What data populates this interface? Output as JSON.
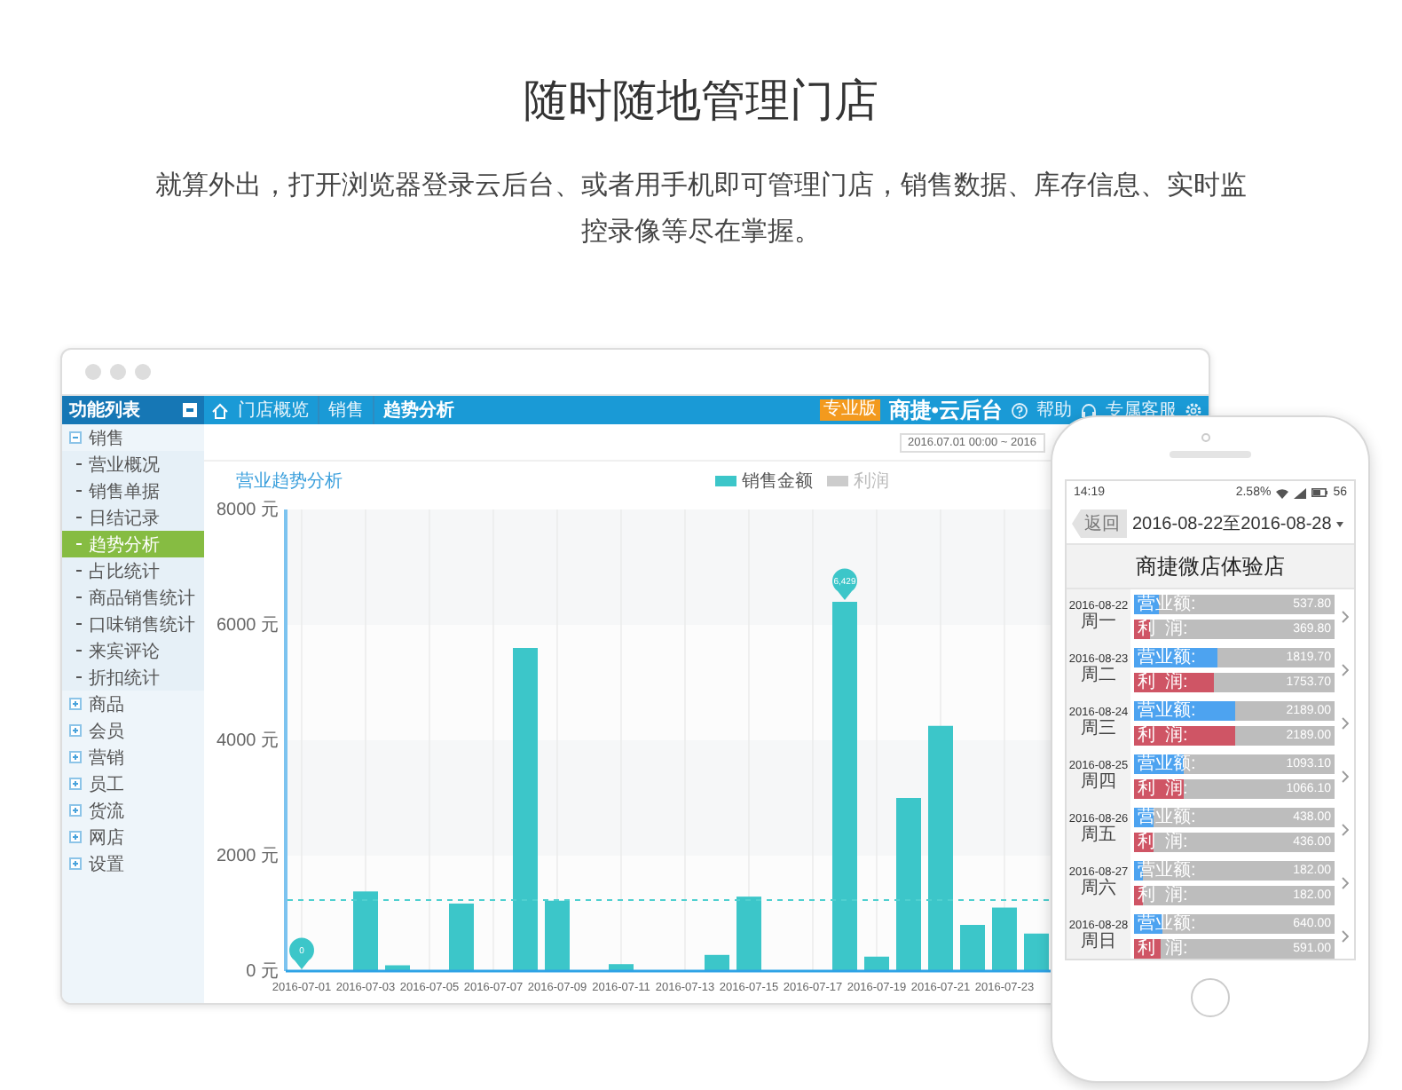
{
  "page": {
    "title": "随时随地管理门店",
    "description": "就算外出，打开浏览器登录云后台、或者用手机即可管理门店，销售数据、库存信息、实时监控录像等尽在掌握。"
  },
  "desktop": {
    "sidebar": {
      "title": "功能列表",
      "items": [
        {
          "label": "销售",
          "expanded": true,
          "children": [
            {
              "label": "营业概况",
              "selected": false
            },
            {
              "label": "销售单据",
              "selected": false
            },
            {
              "label": "日结记录",
              "selected": false
            },
            {
              "label": "趋势分析",
              "selected": true
            },
            {
              "label": "占比统计",
              "selected": false
            },
            {
              "label": "商品销售统计",
              "selected": false
            },
            {
              "label": "口味销售统计",
              "selected": false
            },
            {
              "label": "来宾评论",
              "selected": false
            },
            {
              "label": "折扣统计",
              "selected": false
            }
          ]
        },
        {
          "label": "商品",
          "expanded": false
        },
        {
          "label": "会员",
          "expanded": false
        },
        {
          "label": "营销",
          "expanded": false
        },
        {
          "label": "员工",
          "expanded": false
        },
        {
          "label": "货流",
          "expanded": false
        },
        {
          "label": "网店",
          "expanded": false
        },
        {
          "label": "设置",
          "expanded": false
        }
      ]
    },
    "breadcrumb": [
      "门店概览",
      "销售",
      "趋势分析"
    ],
    "edition_badge": "专业版",
    "brand": "商捷•云后台",
    "help": "帮助",
    "service": "专属客服",
    "date_range": "2016.07.01 00:00 ~ 2016",
    "chart": {
      "title": "营业趋势分析",
      "hidden_series": [
        {
          "label": "利润",
          "color": "#cccccc"
        }
      ],
      "chart_data": {
        "type": "bar",
        "categories": [
          "2016-07-01",
          null,
          "2016-07-03",
          null,
          "2016-07-05",
          null,
          "2016-07-07",
          null,
          "2016-07-09",
          null,
          "2016-07-11",
          null,
          "2016-07-13",
          null,
          "2016-07-15",
          null,
          "2016-07-17",
          null,
          "2016-07-19",
          null,
          "2016-07-21",
          null,
          "2016-07-23",
          null
        ],
        "series": [
          {
            "name": "销售金额",
            "color": "#3cc6c9",
            "values": [
              0,
              0,
              1380,
              100,
              0,
              1170,
              0,
              5600,
              1220,
              0,
              120,
              0,
              null,
              280,
              1290,
              0,
              0,
              6400,
              250,
              3000,
              4250,
              800,
              1100,
              650
            ]
          }
        ],
        "grid": true,
        "ylim": [
          0,
          8000
        ],
        "yticks": [
          {
            "value": 0,
            "label": "0 元"
          },
          {
            "value": 2000,
            "label": "2000 元"
          },
          {
            "value": 4000,
            "label": "4000 元"
          },
          {
            "value": 6000,
            "label": "6000 元"
          },
          {
            "value": 8000,
            "label": "8000 元"
          }
        ],
        "ref_lines": [
          {
            "axis": "y",
            "value": 1230
          }
        ],
        "annotations": [
          {
            "y": 0,
            "text": "0"
          },
          {
            "y": 6400,
            "text": "6,429"
          }
        ]
      }
    }
  },
  "phone": {
    "status": {
      "time": "14:19",
      "network": "2.58%",
      "battery": "56"
    },
    "back": "返回",
    "range": "2016-08-22至2016-08-28",
    "store": "商捷微店体验店",
    "days": [
      {
        "date": "2016-08-22",
        "weekday": "周一",
        "metrics": [
          {
            "kind": "revenue",
            "label": "营业额:",
            "value": "537.80",
            "level": 0.12
          },
          {
            "kind": "profit",
            "label": "利  润:",
            "value": "369.80",
            "level": 0.08
          }
        ]
      },
      {
        "date": "2016-08-23",
        "weekday": "周二",
        "metrics": [
          {
            "kind": "revenue",
            "label": "营业额:",
            "value": "1819.70",
            "level": 0.42
          },
          {
            "kind": "profit",
            "label": "利  润:",
            "value": "1753.70",
            "level": 0.4
          }
        ]
      },
      {
        "date": "2016-08-24",
        "weekday": "周三",
        "metrics": [
          {
            "kind": "revenue",
            "label": "营业额:",
            "value": "2189.00",
            "level": 0.5
          },
          {
            "kind": "profit",
            "label": "利  润:",
            "value": "2189.00",
            "level": 0.5
          }
        ]
      },
      {
        "date": "2016-08-25",
        "weekday": "周四",
        "metrics": [
          {
            "kind": "revenue",
            "label": "营业额:",
            "value": "1093.10",
            "level": 0.25
          },
          {
            "kind": "profit",
            "label": "利  润:",
            "value": "1066.10",
            "level": 0.25
          }
        ]
      },
      {
        "date": "2016-08-26",
        "weekday": "周五",
        "metrics": [
          {
            "kind": "revenue",
            "label": "营业额:",
            "value": "438.00",
            "level": 0.1
          },
          {
            "kind": "profit",
            "label": "利  润:",
            "value": "436.00",
            "level": 0.1
          }
        ]
      },
      {
        "date": "2016-08-27",
        "weekday": "周六",
        "metrics": [
          {
            "kind": "revenue",
            "label": "营业额:",
            "value": "182.00",
            "level": 0.04
          },
          {
            "kind": "profit",
            "label": "利  润:",
            "value": "182.00",
            "level": 0.04
          }
        ]
      },
      {
        "date": "2016-08-28",
        "weekday": "周日",
        "metrics": [
          {
            "kind": "revenue",
            "label": "营业额:",
            "value": "640.00",
            "level": 0.14
          },
          {
            "kind": "profit",
            "label": "利  润:",
            "value": "591.00",
            "level": 0.13
          }
        ]
      }
    ]
  }
}
